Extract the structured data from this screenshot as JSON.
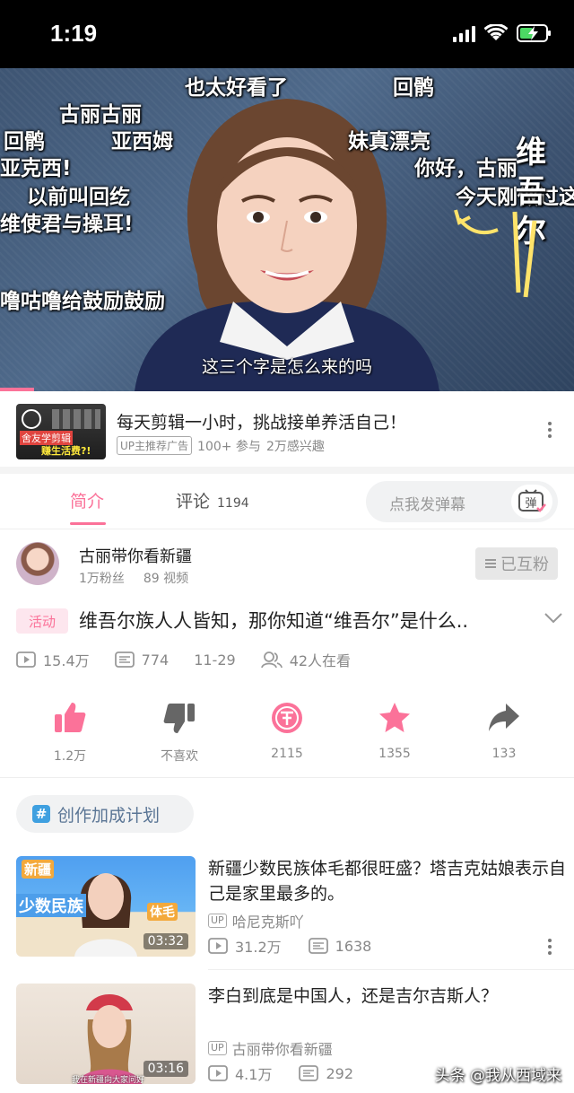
{
  "status_bar": {
    "time": "1:19"
  },
  "video": {
    "danmaku": [
      "也太好看了",
      "回鹘",
      "古丽古丽",
      "回鹘",
      "亚西姆",
      "妹真漂亮",
      "亚克西!",
      "你好，古丽",
      "以前叫回纥",
      "今天刚做过这",
      "维使君与操耳!",
      "噜咕噜给鼓励鼓励"
    ],
    "side_title": "维吾尔",
    "subtitle": "这三个字是怎么来的吗",
    "progress_fraction": 0.06
  },
  "ad": {
    "thumb_text_1": "舍友学剪辑",
    "thumb_text_2": "赚生活费?!",
    "title": "每天剪辑一小时，挑战接单养活自己！",
    "badge": "UP主推荐广告",
    "participants": "100+ 参与",
    "interested": "2万感兴趣"
  },
  "tabs": {
    "intro": "简介",
    "comments": "评论",
    "comment_count": "1194",
    "danmu_placeholder": "点我发弹幕",
    "danmu_icon_char": "弹"
  },
  "uploader": {
    "name": "古丽带你看新疆",
    "fans": "1万粉丝",
    "videos": "89 视频",
    "follow_label": "已互粉"
  },
  "video_info": {
    "activity_tag": "活动",
    "title": "维吾尔族人人皆知，那你知道“维吾尔”是什么..",
    "views": "15.4万",
    "danmaku_count": "774",
    "date": "11-29",
    "watching": "42人在看"
  },
  "actions": {
    "like": "1.2万",
    "dislike": "不喜欢",
    "coin": "2115",
    "favorite": "1355",
    "share": "133"
  },
  "plan_chip": {
    "label": "创作加成计划"
  },
  "recommendations": [
    {
      "title": "新疆少数民族体毛都很旺盛？塔吉克姑娘表示自己是家里最多的。",
      "uploader": "哈尼克斯吖",
      "views": "31.2万",
      "danmaku": "1638",
      "duration": "03:32",
      "thumb_text": [
        "新疆",
        "少数民族",
        "体毛"
      ]
    },
    {
      "title": "李白到底是中国人，还是吉尔吉斯人？",
      "uploader": "古丽带你看新疆",
      "views": "4.1万",
      "danmaku": "292",
      "duration": "03:16",
      "thumb_caption": "我在新疆向大家问好"
    }
  ],
  "up_badge": "UP",
  "watermark": "头条 @我从西域来",
  "colors": {
    "accent": "#fb7299",
    "muted": "#888888",
    "plan_text": "#5a7595"
  }
}
